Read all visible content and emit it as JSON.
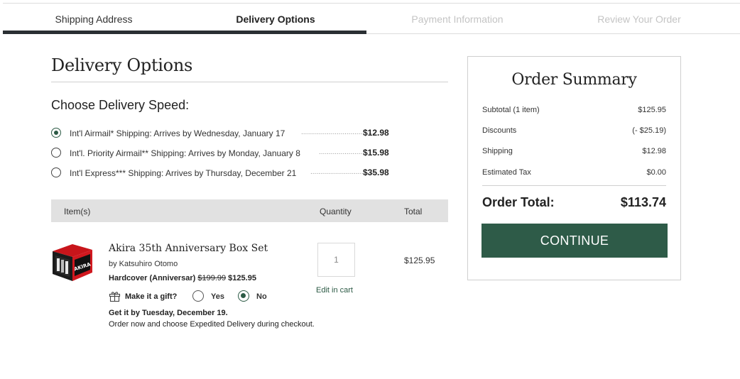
{
  "stepper": {
    "steps": [
      "Shipping Address",
      "Delivery Options",
      "Payment Information",
      "Review Your Order"
    ],
    "active_index": 1
  },
  "page_title": "Delivery Options",
  "speed_heading": "Choose Delivery Speed:",
  "delivery_options": [
    {
      "label": "Int'l Airmail* Shipping:  Arrives by Wednesday, January 17",
      "dots": "......................................",
      "price": "$12.98",
      "selected": true
    },
    {
      "label": "Int'l. Priority Airmail** Shipping:  Arrives by Monday, January 8",
      "dots": "........................",
      "price": "$15.98",
      "selected": false
    },
    {
      "label": "Int'l Express*** Shipping:  Arrives by Thursday, December 21",
      "dots": "..................................",
      "price": "$35.98",
      "selected": false
    }
  ],
  "items_table": {
    "headers": {
      "item": "Item(s)",
      "quantity": "Quantity",
      "total": "Total"
    }
  },
  "product": {
    "title": "Akira 35th Anniversary Box Set",
    "author": "by Katsuhiro Otomo",
    "format": "Hardcover (Anniversar)",
    "original_price": "$199.99",
    "price": "$125.95",
    "gift_label": "Make it a gift?",
    "gift_yes": "Yes",
    "gift_no": "No",
    "gift_selected": "No",
    "get_by": "Get it by Tuesday, December 19.",
    "order_now": "Order now and choose Expedited Delivery during checkout.",
    "quantity": "1",
    "edit_link": "Edit in cart",
    "total": "$125.95",
    "cover_text": "AKIRA"
  },
  "summary": {
    "title": "Order Summary",
    "rows": [
      {
        "label": "Subtotal (1 item)",
        "value": "$125.95"
      },
      {
        "label": "Discounts",
        "value": "(- $25.19)"
      },
      {
        "label": "Shipping",
        "value": "$12.98"
      },
      {
        "label": "Estimated Tax",
        "value": "$0.00"
      }
    ],
    "total_label": "Order Total:",
    "total_value": "$113.74",
    "continue_label": "CONTINUE"
  },
  "colors": {
    "accent": "#2e5b48",
    "progress": "#2a2f33",
    "table_header_bg": "#e1e1e1",
    "disabled_text": "#c4c4c4"
  },
  "icons": [
    "radio-selected-icon",
    "radio-unselected-icon",
    "gift-icon"
  ]
}
